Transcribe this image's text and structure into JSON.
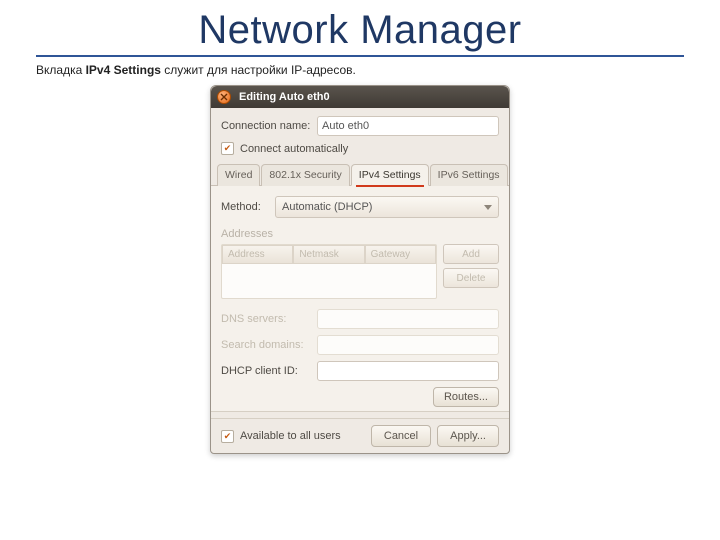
{
  "slide": {
    "title": "Network Manager",
    "caption_prefix": "Вкладка ",
    "caption_bold": "IPv4 Settings",
    "caption_suffix": " служит для настройки IP-адресов."
  },
  "dialog": {
    "title": "Editing Auto eth0",
    "connection_label": "Connection name:",
    "connection_value": "Auto eth0",
    "connect_auto_label": "Connect automatically",
    "tabs": [
      "Wired",
      "802.1x Security",
      "IPv4 Settings",
      "IPv6 Settings"
    ],
    "active_tab": 2,
    "method_label": "Method:",
    "method_value": "Automatic (DHCP)",
    "addresses_title": "Addresses",
    "addr_cols": [
      "Address",
      "Netmask",
      "Gateway"
    ],
    "add_btn": "Add",
    "delete_btn": "Delete",
    "dns_label": "DNS servers:",
    "search_label": "Search domains:",
    "dhcp_label": "DHCP client ID:",
    "routes_btn": "Routes...",
    "avail_label": "Available to all users",
    "cancel_btn": "Cancel",
    "apply_btn": "Apply..."
  }
}
